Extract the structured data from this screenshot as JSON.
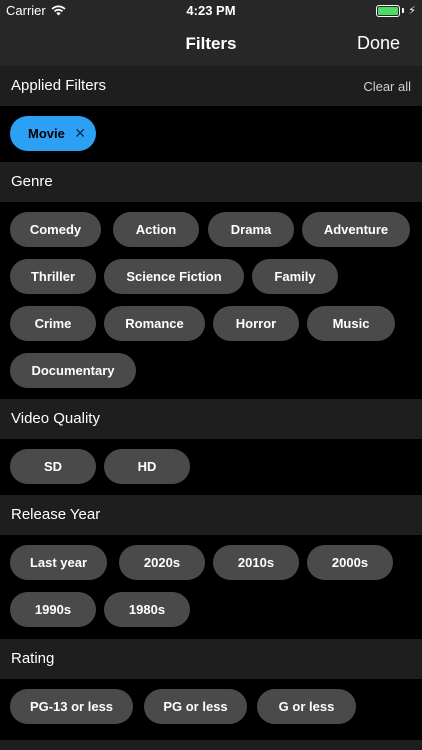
{
  "status": {
    "carrier": "Carrier",
    "time": "4:23 PM",
    "battery_level": 1.0,
    "battery_color": "#4cd964"
  },
  "nav": {
    "title": "Filters",
    "done_label": "Done"
  },
  "applied": {
    "title": "Applied Filters",
    "clear_label": "Clear all",
    "chips": [
      "Movie"
    ],
    "accent": "#2ba0f5"
  },
  "genre": {
    "title": "Genre",
    "chips": [
      "Comedy",
      "Action",
      "Drama",
      "Adventure",
      "Thriller",
      "Science Fiction",
      "Family",
      "Crime",
      "Romance",
      "Horror",
      "Music",
      "Documentary"
    ]
  },
  "quality": {
    "title": "Video Quality",
    "chips": [
      "SD",
      "HD"
    ]
  },
  "year": {
    "title": "Release Year",
    "chips": [
      "Last year",
      "2020s",
      "2010s",
      "2000s",
      "1990s",
      "1980s"
    ]
  },
  "rating": {
    "title": "Rating",
    "chips": [
      "PG-13 or less",
      "PG or less",
      "G or less"
    ]
  }
}
